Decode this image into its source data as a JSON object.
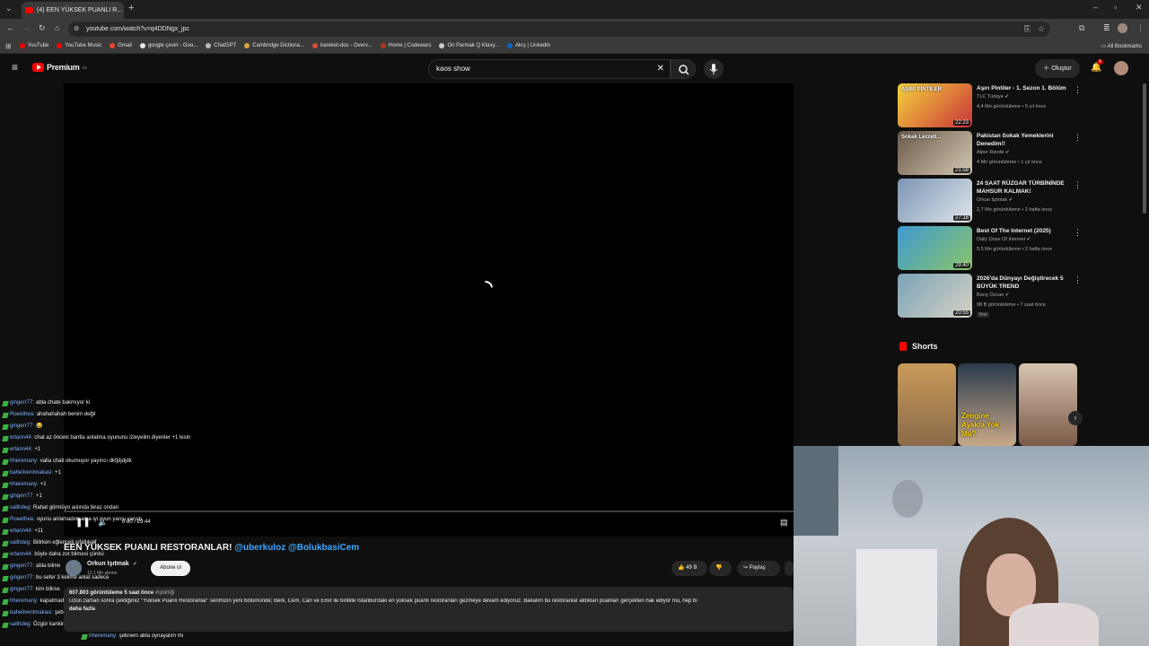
{
  "browser": {
    "tab_title": "(4) EEN YÜKSEK PUANLI R...",
    "url": "youtube.com/watch?v=q4DDNgx_jpc",
    "bookmarks": [
      {
        "label": "YouTube",
        "color": "#ff0000"
      },
      {
        "label": "YouTube Music",
        "color": "#ff0000"
      },
      {
        "label": "Gmail",
        "color": "#ea4335"
      },
      {
        "label": "google çeviri - Goo...",
        "color": "#e8e8e8"
      },
      {
        "label": "ChatGPT",
        "color": "#bbbbbb"
      },
      {
        "label": "Cambridge Dictiona...",
        "color": "#d9a441"
      },
      {
        "label": "hareket-doc - Overv...",
        "color": "#d94c3d"
      },
      {
        "label": "Home | Codewars",
        "color": "#b1361e"
      },
      {
        "label": "On Parmak Q Klavy...",
        "color": "#cccccc"
      },
      {
        "label": "Akış | LinkedIn",
        "color": "#0a66c2"
      }
    ],
    "all_bookmarks": "All Bookmarks"
  },
  "masthead": {
    "logo_text": "Premium",
    "logo_badge": "TR",
    "search_value": "kaos show",
    "create_label": "Oluştur",
    "notifications_count": "4"
  },
  "player": {
    "time": "0:00 / 29:44"
  },
  "video": {
    "title": "EEN YÜKSEK PUANLI RESTORANLAR!",
    "title_links": "@uberkuloz @BolukbasiCem",
    "channel": "Orkun Işıtmak",
    "subscribers": "12,1 Mn abone",
    "subscribe_label": "Abone ol",
    "likes": "49 B",
    "share_label": "Paylaş",
    "views_line": "607.803 görüntüleme  5 saat önce",
    "hashtag": "#işbirliği",
    "description": "Uzun zaman sonra çektiğimiz \"Yüksek Puanlı Restoranlar\" serimizin yeni bölümünde; Berk, Cem, Can ve Emir ile birlikte İstanbul'daki en yüksek puanlı restoranları gezmeye devam ediyoruz. Bakalım bu restoranlar aldıkları puanları gerçekten hak ediyor mu, hep bi",
    "more": "daha fazla"
  },
  "chat": [
    {
      "user": "gingerr77:",
      "msg": "abla chate bakmıyor ki"
    },
    {
      "user": "Roeethea:",
      "msg": "ahahahahah benim değil"
    },
    {
      "user": "gingerr77:",
      "msg": "😂"
    },
    {
      "user": "ertann44:",
      "msg": "chat az önceki bantla anlatma oyununu izleyelim diyenler +1 lesin"
    },
    {
      "user": "ertann44:",
      "msg": "+1"
    },
    {
      "user": "hheremany:",
      "msg": "valla chati okumuyor yayıncı dkfjdjdjdk"
    },
    {
      "user": "baheliventmakasi:",
      "msg": "+1"
    },
    {
      "user": "hheremany:",
      "msg": "+1"
    },
    {
      "user": "gingerr77:",
      "msg": "+1"
    },
    {
      "user": "salihdeg:",
      "msg": "Rahat görmüyo aslında biraz ondan"
    },
    {
      "user": "Roeethea:",
      "msg": "oyunu anlamadım ama iyi oyun yarışı yarıştı"
    },
    {
      "user": "ertann44:",
      "msg": "+11"
    },
    {
      "user": "salihdeg:",
      "msg": "Bilirken eğlenceli sıfatlıkolf"
    },
    {
      "user": "ertann44:",
      "msg": "böyle daha zor bilmesi çünkü"
    },
    {
      "user": "gingerr77:",
      "msg": "abla bilme"
    },
    {
      "user": "gingerr77:",
      "msg": "bu sefer 3 kelime anlat sadece"
    },
    {
      "user": "gingerr77:",
      "msg": "kim bilirse"
    },
    {
      "user": "hheremany:",
      "msg": "kapatmadan gibi oyunu"
    },
    {
      "user": "baheliventmakasi:",
      "msg": "şebnem abla olmayacağı unutmayın"
    },
    {
      "user": "salihdeg:",
      "msg": "Özgür kankim adam bu başında esniyordu"
    },
    {
      "user": "hheremany:",
      "msg": "şebnem abla oynayalım mı"
    }
  ],
  "sidebar": {
    "recs": [
      {
        "title": "Aşırı Pintiler - 1. Sezon 1. Bölüm",
        "channel": "TLC Türkiye",
        "meta": "4,4 Mn görüntüleme • 5 yıl önce",
        "duration": "22:23",
        "thumb_text": "AŞIRI PİNTİLER",
        "colors": [
          "#f5d33b",
          "#c9343a"
        ]
      },
      {
        "title": "Pakistan Sokak Yemeklerini Denedim!!",
        "channel": "Alper Rende",
        "meta": "4 Mn görüntüleme • 1 yıl önce",
        "duration": "21:58",
        "thumb_text": "Sokak Lezzetl...",
        "colors": [
          "#6a5a4a",
          "#d4c8b0"
        ]
      },
      {
        "title": "24 SAAT RÜZGAR TÜRBİNİNDE MAHSUR KALMAK!",
        "channel": "Orkun Işıtmak",
        "meta": "2,7 Mn görüntüleme • 2 hafta önce",
        "duration": "27:18",
        "thumb_text": "",
        "colors": [
          "#7b95b3",
          "#e0e6ec"
        ]
      },
      {
        "title": "Best Of The Internet (2025)",
        "channel": "Daily Dose Of Internet",
        "meta": "5,5 Mn görüntüleme • 2 hafta önce",
        "duration": "29:40",
        "thumb_text": "",
        "colors": [
          "#3d9ad1",
          "#8bc46a"
        ]
      },
      {
        "title": "2026'da Dünyayı Değiştirecek 5 BÜYÜK TREND",
        "channel": "Barış Özcan",
        "meta": "98 B görüntüleme • 7 saat önce",
        "duration": "20:55",
        "thumb_text": "",
        "badge": "Yeni",
        "colors": [
          "#7aa3b8",
          "#d6d2c4"
        ]
      }
    ],
    "shorts_label": "Shorts",
    "shorts": [
      {
        "text": "",
        "colors": [
          "#c99a5a",
          "#8a6a48"
        ]
      },
      {
        "text": "Zengine Ayakta Yok Mu?",
        "colors": [
          "#2a3a4a",
          "#c8a88a"
        ]
      },
      {
        "text": "",
        "colors": [
          "#d8c4b0",
          "#7a5a48"
        ]
      }
    ]
  }
}
